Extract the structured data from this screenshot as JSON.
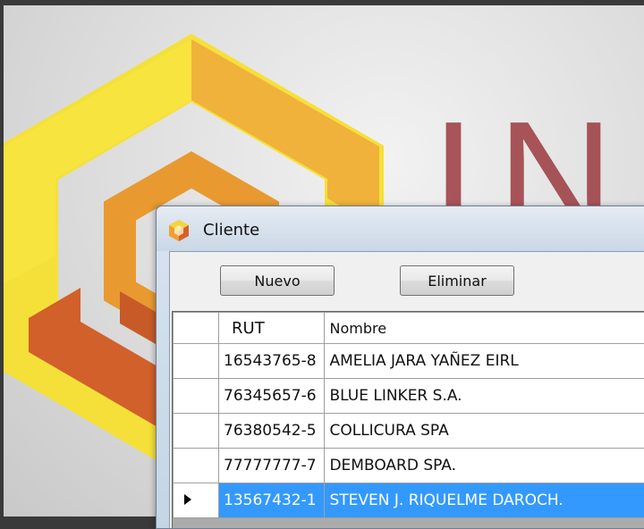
{
  "background": {
    "brand_text": "IN",
    "brand_color": "#9c3a3f",
    "logo_colors": [
      "#f5e03a",
      "#f0b23a",
      "#d2602a"
    ]
  },
  "window": {
    "title": "Cliente",
    "icon": "app-hexagon-icon"
  },
  "toolbar": {
    "nuevo_label": "Nuevo",
    "eliminar_label": "Eliminar"
  },
  "grid": {
    "columns": [
      "RUT",
      "Nombre"
    ],
    "rows": [
      {
        "rut": "16543765-8",
        "nombre": "AMELIA JARA YAÑEZ EIRL"
      },
      {
        "rut": "76345657-6",
        "nombre": "BLUE LINKER S.A."
      },
      {
        "rut": "76380542-5",
        "nombre": "COLLICURA SPA"
      },
      {
        "rut": "77777777-7",
        "nombre": "DEMBOARD SPA."
      },
      {
        "rut": "13567432-1",
        "nombre": "STEVEN J. RIQUELME DAROCH."
      }
    ],
    "selected_row": 4,
    "selection_color": "#3399ff"
  }
}
